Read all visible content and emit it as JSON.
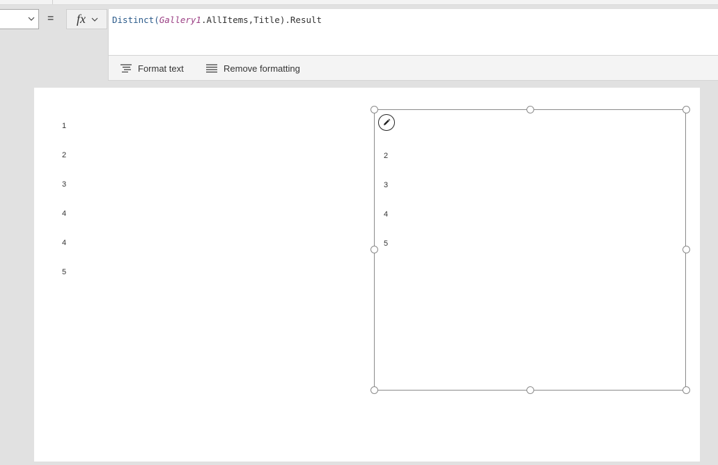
{
  "formula_bar": {
    "equals": "=",
    "fx_label": "fx",
    "formula": {
      "fn": "Distinct(",
      "control": "Gallery1",
      "rest": ".AllItems,Title).Result"
    }
  },
  "format_bar": {
    "format_text_label": "Format text",
    "remove_formatting_label": "Remove formatting"
  },
  "canvas": {
    "gallery_left": {
      "items": [
        "1",
        "2",
        "3",
        "4",
        "4",
        "5"
      ]
    },
    "gallery_right": {
      "items": [
        "2",
        "3",
        "4",
        "5"
      ]
    }
  },
  "colors": {
    "function": "#2a5a8a",
    "control_reference": "#9b3f84",
    "canvas_background": "#e1e1e1",
    "selection_border": "#8a8a8a"
  },
  "icons": [
    "chevron-down-icon",
    "format-text-icon",
    "remove-formatting-icon",
    "edit-pencil-icon"
  ]
}
